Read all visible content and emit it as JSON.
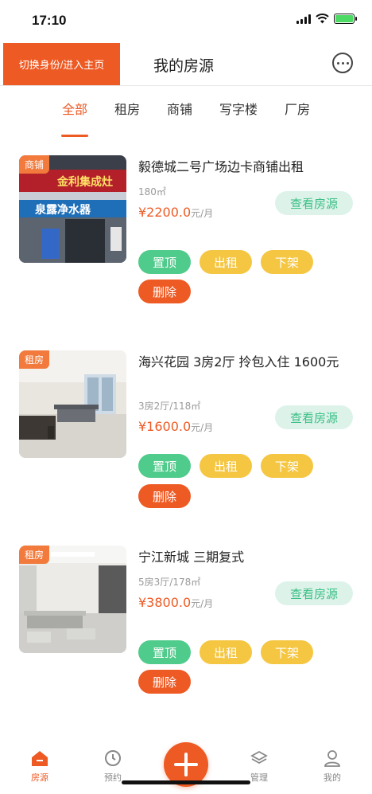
{
  "status": {
    "time": "17:10"
  },
  "header": {
    "switch_label": "切换身份/进入主页",
    "title": "我的房源"
  },
  "tabs": [
    {
      "label": "全部",
      "active": true
    },
    {
      "label": "租房",
      "active": false
    },
    {
      "label": "商铺",
      "active": false
    },
    {
      "label": "写字楼",
      "active": false
    },
    {
      "label": "厂房",
      "active": false
    }
  ],
  "listings": [
    {
      "tag": "商铺",
      "title": "毅德城二号广场边卡商铺出租",
      "meta": "180㎡",
      "price": "¥2200.0",
      "unit": "元/月",
      "view_label": "查看房源",
      "actions": [
        "置顶",
        "出租",
        "下架",
        "删除"
      ],
      "sign_text": "金利集成灶",
      "sign_text2": "泉露净水器"
    },
    {
      "tag": "租房",
      "title": "海兴花园 3房2厅 拎包入住 1600元",
      "meta": "3房2厅/118㎡",
      "price": "¥1600.0",
      "unit": "元/月",
      "view_label": "查看房源",
      "actions": [
        "置顶",
        "出租",
        "下架",
        "删除"
      ]
    },
    {
      "tag": "租房",
      "title": "宁江新城 三期复式",
      "meta": "5房3厅/178㎡",
      "price": "¥3800.0",
      "unit": "元/月",
      "view_label": "查看房源",
      "actions": [
        "置顶",
        "出租",
        "下架",
        "删除"
      ]
    }
  ],
  "bottom_nav": [
    {
      "label": "房源",
      "icon": "house-icon",
      "active": true
    },
    {
      "label": "预约",
      "icon": "clock-icon",
      "active": false
    },
    {
      "label": "管理",
      "icon": "layers-icon",
      "active": false
    },
    {
      "label": "我的",
      "icon": "person-icon",
      "active": false
    }
  ],
  "colors": {
    "accent": "#ee5a24",
    "green": "#4fcb8b",
    "yellow": "#f5c642",
    "view_bg": "#ddf3ea",
    "view_text": "#3cbf85"
  }
}
